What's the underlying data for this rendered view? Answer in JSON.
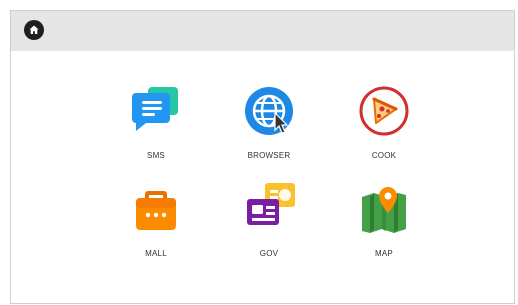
{
  "topbar": {
    "home_icon": "home-icon"
  },
  "apps": [
    {
      "id": "sms",
      "label": "SMS",
      "icon": "message-icon",
      "color": "#2196f3"
    },
    {
      "id": "browser",
      "label": "BROWSER",
      "icon": "globe-icon",
      "color": "#1e88e5"
    },
    {
      "id": "cook",
      "label": "COOK",
      "icon": "pizza-icon",
      "color": "#d32f2f"
    },
    {
      "id": "mall",
      "label": "MALL",
      "icon": "briefcase-icon",
      "color": "#f57c00"
    },
    {
      "id": "gov",
      "label": "GOV",
      "icon": "id-card-icon",
      "color": "#7b1fa2"
    },
    {
      "id": "map",
      "label": "MAP",
      "icon": "map-pin-icon",
      "color": "#43a047"
    }
  ]
}
